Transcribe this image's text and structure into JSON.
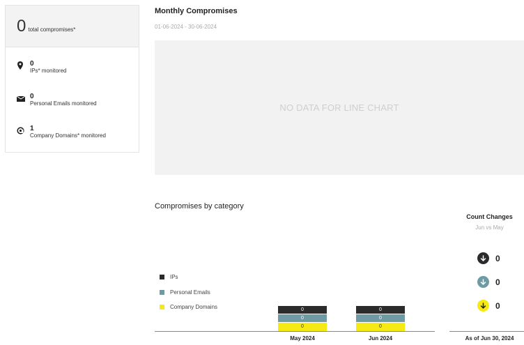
{
  "summary": {
    "total_count": "0",
    "total_label": "total compromises*",
    "stats": [
      {
        "icon": "map-marker-icon",
        "count": "0",
        "label": "IPs* monitored"
      },
      {
        "icon": "envelope-icon",
        "count": "0",
        "label": "Personal Emails monitored"
      },
      {
        "icon": "at-sign-icon",
        "count": "1",
        "label": "Company Domains* monitored"
      }
    ]
  },
  "monthly": {
    "title": "Monthly Compromises",
    "date_range": "01-06-2024 - 30-06-2024",
    "empty_text": "NO DATA FOR LINE CHART"
  },
  "category": {
    "title": "Compromises by category",
    "legend": [
      {
        "label": "IPs",
        "color": "#2b2b2b"
      },
      {
        "label": "Personal Emails",
        "color": "#6e9aa3"
      },
      {
        "label": "Company Domains",
        "color": "#f5ea14"
      }
    ]
  },
  "chart_data": {
    "type": "bar",
    "stacked": true,
    "categories": [
      "May 2024",
      "Jun 2024"
    ],
    "series": [
      {
        "name": "IPs",
        "values": [
          0,
          0
        ]
      },
      {
        "name": "Personal Emails",
        "values": [
          0,
          0
        ]
      },
      {
        "name": "Company Domains",
        "values": [
          0,
          0
        ]
      }
    ],
    "legend_position": "left"
  },
  "count_changes": {
    "title": "Count Changes",
    "subtitle": "Jun vs May",
    "items": [
      {
        "value": "0",
        "color": "#2b2b2b",
        "icon": "arrow-down-icon"
      },
      {
        "value": "0",
        "color": "#6e9aa3",
        "icon": "arrow-down-icon"
      },
      {
        "value": "0",
        "color": "#f5ea14",
        "icon": "arrow-down-icon"
      }
    ],
    "as_of": "As of Jun 30, 2024"
  }
}
